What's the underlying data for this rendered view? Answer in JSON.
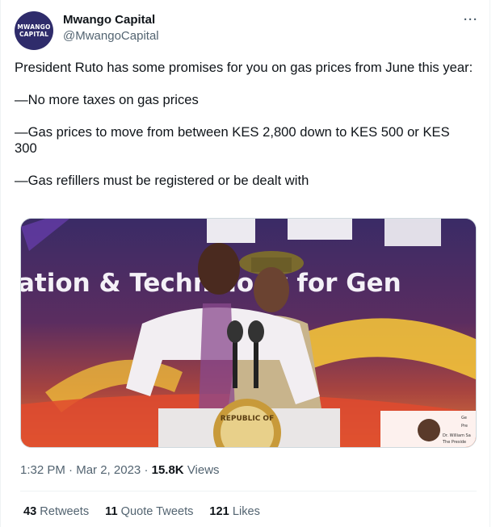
{
  "author": {
    "display_name": "Mwango Capital",
    "handle": "@MwangoCapital",
    "avatar_line1": "MWANGO",
    "avatar_line2": "CAPITAL"
  },
  "menu": {
    "more_label": "···"
  },
  "tweet": {
    "paragraphs": [
      "President Ruto has some promises for you on gas prices from June this year:",
      "—No more taxes on gas prices",
      "—Gas prices to move from between KES 2,800 down to KES 500 or KES 300",
      "—Gas refillers must be registered or be dealt with"
    ]
  },
  "media": {
    "banner_text": "ation & Technology for Gen",
    "seal_text": "REPUBLIC OF",
    "inset_lines": [
      "Ge",
      "Pre",
      "Dr. William Sa",
      "The Preside"
    ]
  },
  "meta": {
    "time": "1:32 PM",
    "separator": "·",
    "date": "Mar 2, 2023",
    "views_count": "15.8K",
    "views_label": "Views"
  },
  "stats": {
    "retweets_count": "43",
    "retweets_label": "Retweets",
    "quotes_count": "11",
    "quotes_label": "Quote Tweets",
    "likes_count": "121",
    "likes_label": "Likes"
  },
  "colors": {
    "text": "#0f1419",
    "secondary": "#536471",
    "border": "#eff3f4",
    "avatar_bg": "#2f2c6b"
  }
}
